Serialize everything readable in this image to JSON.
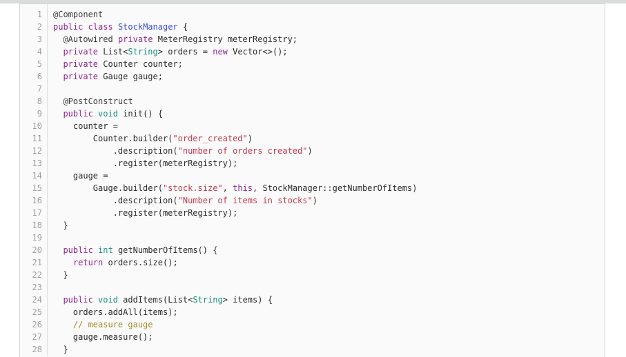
{
  "window": {
    "background_color": "#ffffff",
    "top_band_color": "#d9dcdd"
  },
  "code_block": {
    "language": "java",
    "background_color": "#fafafa",
    "border_color": "#d8d8d8",
    "gutter_color": "#a0a0a0",
    "first_line_number": 1,
    "last_line_number": 28,
    "colors": {
      "keyword": "#8f278f",
      "type": "#1a8f80",
      "class_name": "#3a4fcc",
      "string": "#c13a4a",
      "comment": "#a08a28",
      "annotation": "#3b3b3b",
      "plain": "#2c2c2c"
    },
    "lines": [
      {
        "number": "1",
        "tokens": [
          {
            "t": "@Component",
            "c": "ann"
          }
        ]
      },
      {
        "number": "2",
        "tokens": [
          {
            "t": "public",
            "c": "kw"
          },
          {
            "t": " ",
            "c": "pl"
          },
          {
            "t": "class",
            "c": "kw"
          },
          {
            "t": " ",
            "c": "pl"
          },
          {
            "t": "StockManager",
            "c": "cls"
          },
          {
            "t": " {",
            "c": "pl"
          }
        ]
      },
      {
        "number": "3",
        "tokens": [
          {
            "t": "  ",
            "c": "pl"
          },
          {
            "t": "@Autowired",
            "c": "ann"
          },
          {
            "t": " ",
            "c": "pl"
          },
          {
            "t": "private",
            "c": "kw"
          },
          {
            "t": " MeterRegistry meterRegistry;",
            "c": "pl"
          }
        ]
      },
      {
        "number": "4",
        "tokens": [
          {
            "t": "  ",
            "c": "pl"
          },
          {
            "t": "private",
            "c": "kw"
          },
          {
            "t": " List<",
            "c": "pl"
          },
          {
            "t": "String",
            "c": "type"
          },
          {
            "t": "> orders = ",
            "c": "pl"
          },
          {
            "t": "new",
            "c": "kw"
          },
          {
            "t": " Vector<>();",
            "c": "pl"
          }
        ]
      },
      {
        "number": "5",
        "tokens": [
          {
            "t": "  ",
            "c": "pl"
          },
          {
            "t": "private",
            "c": "kw"
          },
          {
            "t": " Counter counter;",
            "c": "pl"
          }
        ]
      },
      {
        "number": "6",
        "tokens": [
          {
            "t": "  ",
            "c": "pl"
          },
          {
            "t": "private",
            "c": "kw"
          },
          {
            "t": " Gauge gauge;",
            "c": "pl"
          }
        ]
      },
      {
        "number": "7",
        "tokens": [
          {
            "t": "",
            "c": "pl"
          }
        ]
      },
      {
        "number": "8",
        "tokens": [
          {
            "t": "  ",
            "c": "pl"
          },
          {
            "t": "@PostConstruct",
            "c": "ann"
          }
        ]
      },
      {
        "number": "9",
        "tokens": [
          {
            "t": "  ",
            "c": "pl"
          },
          {
            "t": "public",
            "c": "kw"
          },
          {
            "t": " ",
            "c": "pl"
          },
          {
            "t": "void",
            "c": "type"
          },
          {
            "t": " init() {",
            "c": "pl"
          }
        ]
      },
      {
        "number": "10",
        "tokens": [
          {
            "t": "    counter =",
            "c": "pl"
          }
        ]
      },
      {
        "number": "11",
        "tokens": [
          {
            "t": "        Counter.builder(",
            "c": "pl"
          },
          {
            "t": "\"order_created\"",
            "c": "str"
          },
          {
            "t": ")",
            "c": "pl"
          }
        ]
      },
      {
        "number": "12",
        "tokens": [
          {
            "t": "            .description(",
            "c": "pl"
          },
          {
            "t": "\"number of orders created\"",
            "c": "str"
          },
          {
            "t": ")",
            "c": "pl"
          }
        ]
      },
      {
        "number": "13",
        "tokens": [
          {
            "t": "            .register(meterRegistry);",
            "c": "pl"
          }
        ]
      },
      {
        "number": "14",
        "tokens": [
          {
            "t": "    gauge =",
            "c": "pl"
          }
        ]
      },
      {
        "number": "15",
        "tokens": [
          {
            "t": "        Gauge.builder(",
            "c": "pl"
          },
          {
            "t": "\"stock.size\"",
            "c": "str"
          },
          {
            "t": ", ",
            "c": "pl"
          },
          {
            "t": "this",
            "c": "kw"
          },
          {
            "t": ", StockManager::getNumberOfItems)",
            "c": "pl"
          }
        ]
      },
      {
        "number": "16",
        "tokens": [
          {
            "t": "            .description(",
            "c": "pl"
          },
          {
            "t": "\"Number of items in stocks\"",
            "c": "str"
          },
          {
            "t": ")",
            "c": "pl"
          }
        ]
      },
      {
        "number": "17",
        "tokens": [
          {
            "t": "            .register(meterRegistry);",
            "c": "pl"
          }
        ]
      },
      {
        "number": "18",
        "tokens": [
          {
            "t": "  }",
            "c": "pl"
          }
        ]
      },
      {
        "number": "19",
        "tokens": [
          {
            "t": "",
            "c": "pl"
          }
        ]
      },
      {
        "number": "20",
        "tokens": [
          {
            "t": "  ",
            "c": "pl"
          },
          {
            "t": "public",
            "c": "kw"
          },
          {
            "t": " ",
            "c": "pl"
          },
          {
            "t": "int",
            "c": "type"
          },
          {
            "t": " getNumberOfItems() {",
            "c": "pl"
          }
        ]
      },
      {
        "number": "21",
        "tokens": [
          {
            "t": "    ",
            "c": "pl"
          },
          {
            "t": "return",
            "c": "kw"
          },
          {
            "t": " orders.size();",
            "c": "pl"
          }
        ]
      },
      {
        "number": "22",
        "tokens": [
          {
            "t": "  }",
            "c": "pl"
          }
        ]
      },
      {
        "number": "23",
        "tokens": [
          {
            "t": "",
            "c": "pl"
          }
        ]
      },
      {
        "number": "24",
        "tokens": [
          {
            "t": "  ",
            "c": "pl"
          },
          {
            "t": "public",
            "c": "kw"
          },
          {
            "t": " ",
            "c": "pl"
          },
          {
            "t": "void",
            "c": "type"
          },
          {
            "t": " addItems(List<",
            "c": "pl"
          },
          {
            "t": "String",
            "c": "type"
          },
          {
            "t": "> items) {",
            "c": "pl"
          }
        ]
      },
      {
        "number": "25",
        "tokens": [
          {
            "t": "    orders.addAll(items);",
            "c": "pl"
          }
        ]
      },
      {
        "number": "26",
        "tokens": [
          {
            "t": "    ",
            "c": "pl"
          },
          {
            "t": "// measure gauge",
            "c": "cmt"
          }
        ]
      },
      {
        "number": "27",
        "tokens": [
          {
            "t": "    gauge.measure();",
            "c": "pl"
          }
        ]
      },
      {
        "number": "28",
        "tokens": [
          {
            "t": "  }",
            "c": "pl"
          }
        ]
      }
    ]
  }
}
